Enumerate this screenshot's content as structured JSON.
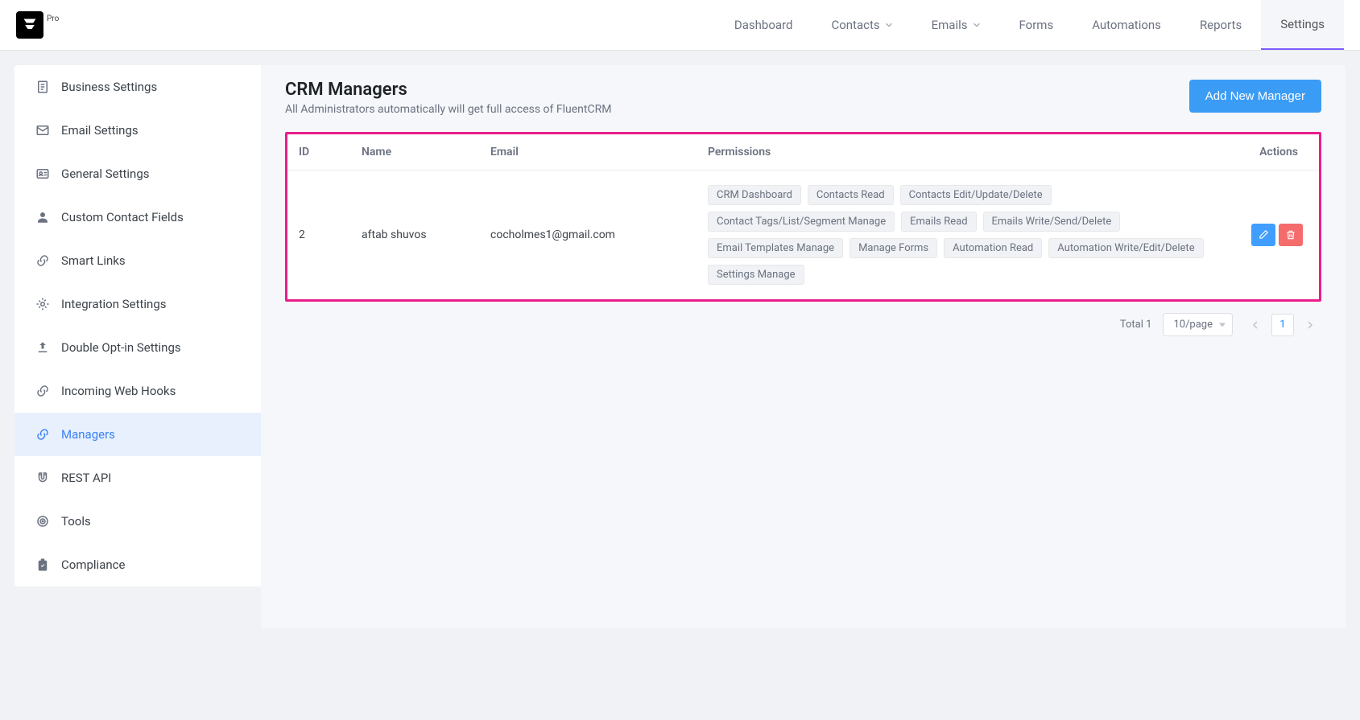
{
  "logo": {
    "badge": "Pro"
  },
  "topnav": {
    "dashboard": "Dashboard",
    "contacts": "Contacts",
    "emails": "Emails",
    "forms": "Forms",
    "automations": "Automations",
    "reports": "Reports",
    "settings": "Settings"
  },
  "sidebar": {
    "items": [
      {
        "label": "Business Settings"
      },
      {
        "label": "Email Settings"
      },
      {
        "label": "General Settings"
      },
      {
        "label": "Custom Contact Fields"
      },
      {
        "label": "Smart Links"
      },
      {
        "label": "Integration Settings"
      },
      {
        "label": "Double Opt-in Settings"
      },
      {
        "label": "Incoming Web Hooks"
      },
      {
        "label": "Managers"
      },
      {
        "label": "REST API"
      },
      {
        "label": "Tools"
      },
      {
        "label": "Compliance"
      }
    ]
  },
  "page": {
    "title": "CRM Managers",
    "subtitle": "All Administrators automatically will get full access of FluentCRM",
    "add_btn": "Add New Manager"
  },
  "table": {
    "headers": {
      "id": "ID",
      "name": "Name",
      "email": "Email",
      "permissions": "Permissions",
      "actions": "Actions"
    },
    "rows": [
      {
        "id": "2",
        "name": "aftab shuvos",
        "email": "cocholmes1@gmail.com",
        "permissions": [
          "CRM Dashboard",
          "Contacts Read",
          "Contacts Edit/Update/Delete",
          "Contact Tags/List/Segment Manage",
          "Emails Read",
          "Emails Write/Send/Delete",
          "Email Templates Manage",
          "Manage Forms",
          "Automation Read",
          "Automation Write/Edit/Delete",
          "Settings Manage"
        ]
      }
    ]
  },
  "pagination": {
    "total_label": "Total 1",
    "page_size": "10/page",
    "current": "1"
  }
}
